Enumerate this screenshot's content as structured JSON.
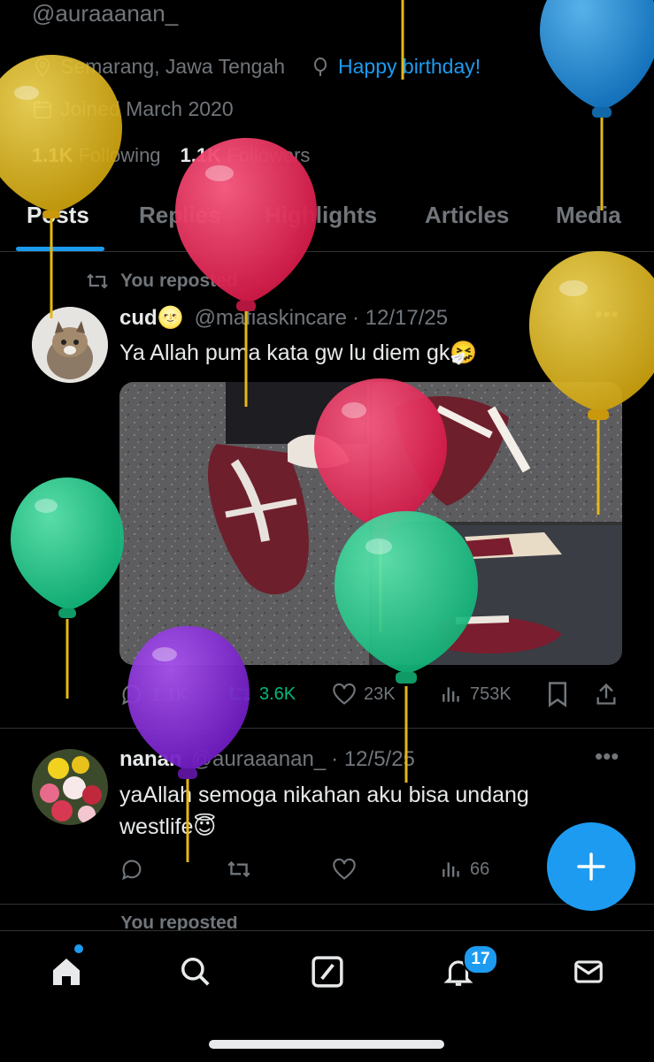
{
  "profile": {
    "handle": "@auraaanan_",
    "location": "Semarang, Jawa Tengah",
    "birthday": "Happy birthday!",
    "joined": "Joined March 2020",
    "following_count": "1.1K",
    "following_label": "Following",
    "followers_count": "1.1K",
    "followers_label": "Followers"
  },
  "tabs": [
    {
      "label": "Posts"
    },
    {
      "label": "Replies"
    },
    {
      "label": "Highlights"
    },
    {
      "label": "Articles"
    },
    {
      "label": "Media"
    }
  ],
  "posts": [
    {
      "repost_label": "You reposted",
      "name": "cud🌝",
      "handle": "@mafiaskincare",
      "date": "· 12/17/25",
      "text": "Ya Allah puma kata gw lu diem gk🤧",
      "replies": "1.1K",
      "reposts": "3.6K",
      "likes": "23K",
      "views": "753K"
    },
    {
      "name": "nanan",
      "handle": "@auraaanan_",
      "date": "· 12/5/25",
      "text_line1": "yaAllah semoga nikahan aku bisa undang",
      "text_line2": "westlife😇",
      "views": "66"
    }
  ],
  "next_post_preview": "You reposted",
  "notifications_badge": "17",
  "colors": {
    "accent": "#1d9bf0",
    "repost_active": "#00ba7c",
    "balloon_yellow": "#e5b817",
    "balloon_red": "#f0245a",
    "balloon_blue": "#1d8fe0",
    "balloon_green": "#1fd08f",
    "balloon_purple": "#8c2fd8"
  },
  "icons": {
    "location": "location-pin-icon",
    "birthday": "balloon-icon",
    "joined": "calendar-icon",
    "repost": "repost-icon",
    "reply": "reply-icon",
    "like": "heart-icon",
    "views": "views-icon",
    "bookmark": "bookmark-icon",
    "share": "share-icon",
    "more": "more-icon",
    "compose": "plus-icon",
    "home": "home-icon",
    "search": "search-icon",
    "grok": "grok-icon",
    "notifications": "bell-icon",
    "messages": "mail-icon"
  }
}
